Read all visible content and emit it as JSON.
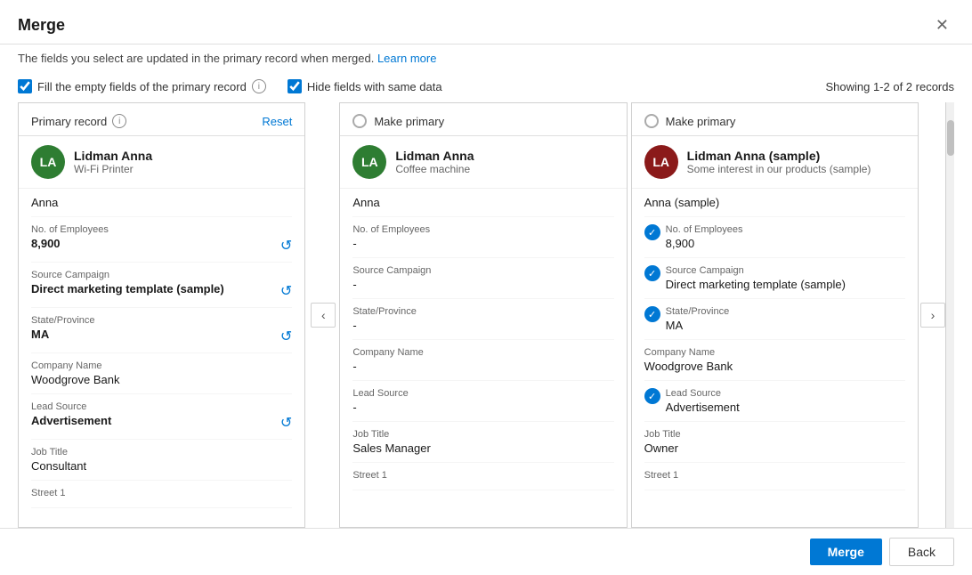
{
  "dialog": {
    "title": "Merge",
    "subtitle": "The fields you select are updated in the primary record when merged.",
    "learn_more": "Learn more",
    "close_label": "✕"
  },
  "options": {
    "fill_empty_label": "Fill the empty fields of the primary record",
    "hide_same_label": "Hide fields with same data",
    "showing_text": "Showing 1-2 of 2 records"
  },
  "column1": {
    "header_label": "Primary record",
    "reset_label": "Reset",
    "avatar_initials": "LA",
    "name": "Lidman Anna",
    "subtitle": "Wi-Fi Printer",
    "first_name_label": "",
    "first_name_value": "Anna",
    "employees_label": "No. of Employees",
    "employees_value": "8,900",
    "source_label": "Source Campaign",
    "source_value": "Direct marketing template (sample)",
    "state_label": "State/Province",
    "state_value": "MA",
    "company_label": "Company Name",
    "company_value": "Woodgrove Bank",
    "lead_label": "Lead Source",
    "lead_value": "Advertisement",
    "job_label": "Job Title",
    "job_value": "Consultant",
    "street_label": "Street 1"
  },
  "column2": {
    "header_label": "Make primary",
    "avatar_initials": "LA",
    "name": "Lidman Anna",
    "subtitle": "Coffee machine",
    "first_name_value": "Anna",
    "employees_label": "No. of Employees",
    "employees_value": "-",
    "source_label": "Source Campaign",
    "source_value": "-",
    "state_label": "State/Province",
    "state_value": "-",
    "company_label": "Company Name",
    "company_value": "-",
    "lead_label": "Lead Source",
    "lead_value": "-",
    "job_label": "Job Title",
    "job_value": "Sales Manager",
    "street_label": "Street 1"
  },
  "column3": {
    "header_label": "Make primary",
    "avatar_initials": "LA",
    "name": "Lidman Anna (sample)",
    "subtitle": "Some interest in our products (sample)",
    "first_name_value": "Anna (sample)",
    "employees_label": "No. of Employees",
    "employees_value": "8,900",
    "source_label": "Source Campaign",
    "source_value": "Direct marketing template (sample)",
    "state_label": "State/Province",
    "state_value": "MA",
    "company_label": "Company Name",
    "company_value": "Woodgrove Bank",
    "lead_label": "Lead Source",
    "lead_value": "Advertisement",
    "job_label": "Job Title",
    "job_value": "Owner",
    "street_label": "Street 1"
  },
  "footer": {
    "merge_label": "Merge",
    "back_label": "Back"
  }
}
